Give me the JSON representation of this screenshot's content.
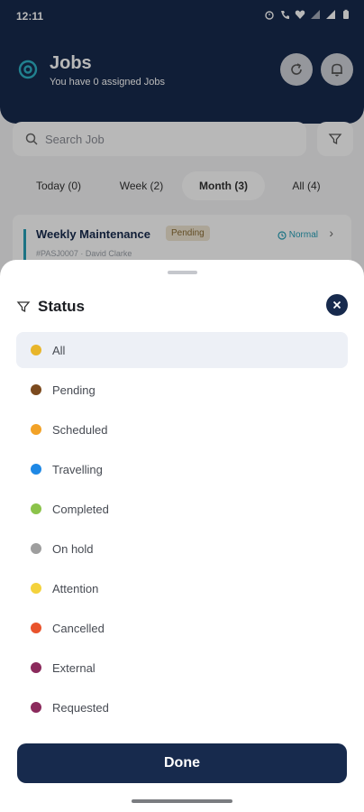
{
  "status_bar": {
    "time": "12:11"
  },
  "header": {
    "title": "Jobs",
    "subtitle": "You have 0 assigned Jobs"
  },
  "search": {
    "placeholder": "Search Job"
  },
  "tabs": [
    {
      "label": "Today (0)"
    },
    {
      "label": "Week (2)"
    },
    {
      "label": "Month (3)"
    },
    {
      "label": "All (4)"
    }
  ],
  "job": {
    "title": "Weekly Maintenance",
    "status": "Pending",
    "ref": "#PASJ0007 · David Clarke",
    "priority": "Normal"
  },
  "sheet": {
    "title": "Status",
    "options": [
      {
        "label": "All",
        "color": "#E8B52A"
      },
      {
        "label": "Pending",
        "color": "#7B4A1E"
      },
      {
        "label": "Scheduled",
        "color": "#F2A227"
      },
      {
        "label": "Travelling",
        "color": "#1E88E5"
      },
      {
        "label": "Completed",
        "color": "#8BC34A"
      },
      {
        "label": "On hold",
        "color": "#9E9E9E"
      },
      {
        "label": "Attention",
        "color": "#F4D23C"
      },
      {
        "label": "Cancelled",
        "color": "#E9532C"
      },
      {
        "label": "External",
        "color": "#8B2A5C"
      },
      {
        "label": "Requested",
        "color": "#8B2A5C"
      }
    ],
    "selected_index": 0,
    "done_label": "Done"
  },
  "colors": {
    "primary": "#172A4D",
    "accent": "#27A0B8"
  }
}
